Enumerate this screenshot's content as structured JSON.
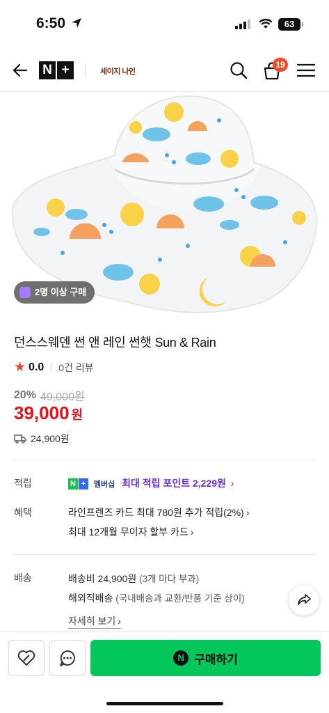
{
  "status": {
    "time": "6:50",
    "battery": "63"
  },
  "header": {
    "logo_n": "N",
    "logo_plus": "+",
    "brand": "세이지 나인",
    "cart_count": "19"
  },
  "product": {
    "group_badge": "2명 이상 구매",
    "title": "던스스웨덴 썬 앤 레인 썬햇 Sun & Rain",
    "rating": "0.0",
    "reviews": "0건 리뷰",
    "discount_pct": "20%",
    "original_price": "49,000원",
    "price": "39,000",
    "price_unit": "원",
    "shipping_fee": "24,900원"
  },
  "rows": {
    "points_label": "적립",
    "membership_tag": "멤버십",
    "points_text": "최대 적립 포인트 2,229원",
    "benefit_label": "혜택",
    "benefit_1": "라인프렌즈 카드 최대 780원 추가 적립(2%)",
    "benefit_2": "최대 12개월 무이자 할부 카드",
    "delivery_label": "배송",
    "delivery_fee": "배송비 24,900원",
    "delivery_fee_note": "(3개 마다 부과)",
    "overseas": "해외직배송",
    "overseas_note": "(국내배송과 교환/반품 기준 상이)",
    "detail_link": "자세히 보기"
  },
  "bottom": {
    "buy_label": "구매하기"
  },
  "colors": {
    "price_red": "#e2131c",
    "buy_green": "#03c75a",
    "points_purple": "#6c2bd9"
  },
  "icons": [
    "location-arrow-icon",
    "signal-icon",
    "wifi-icon",
    "back-arrow-icon",
    "search-icon",
    "cart-icon",
    "menu-icon",
    "star-icon",
    "truck-icon",
    "share-icon",
    "wishlist-heart-icon",
    "chat-icon"
  ]
}
